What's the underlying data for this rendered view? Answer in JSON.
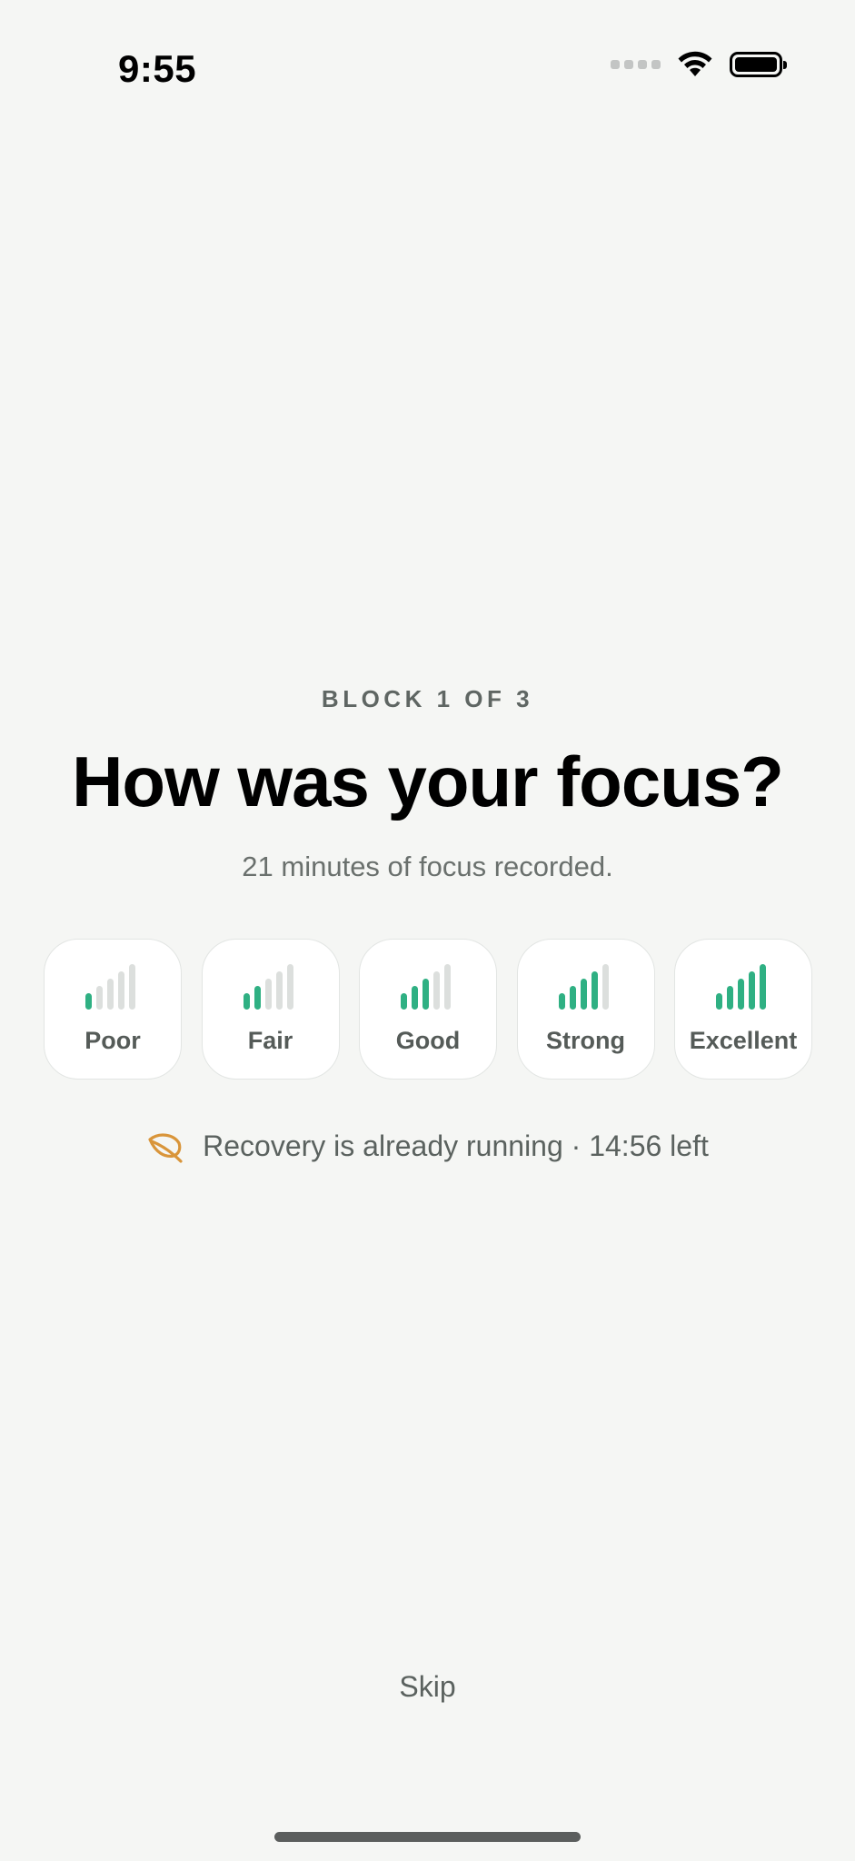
{
  "status_bar": {
    "time": "9:55",
    "icons": [
      "signal-dots-icon",
      "wifi-icon",
      "battery-icon"
    ]
  },
  "checkin": {
    "eyebrow": "BLOCK 1 OF 3",
    "title": "How was your focus?",
    "subtitle": "21 minutes of focus recorded."
  },
  "ratings": [
    {
      "label": "Poor",
      "level": 1,
      "max": 5
    },
    {
      "label": "Fair",
      "level": 2,
      "max": 5
    },
    {
      "label": "Good",
      "level": 3,
      "max": 5
    },
    {
      "label": "Strong",
      "level": 4,
      "max": 5
    },
    {
      "label": "Excellent",
      "level": 5,
      "max": 5
    }
  ],
  "recovery": {
    "icon": "leaf-icon",
    "text": "Recovery is already running · 14:56 left"
  },
  "skip_label": "Skip",
  "colors": {
    "accent_green": "#2fb083",
    "inactive_bar": "#dcdfdd",
    "leaf_orange": "#d9953a",
    "background": "#f5f6f4"
  }
}
